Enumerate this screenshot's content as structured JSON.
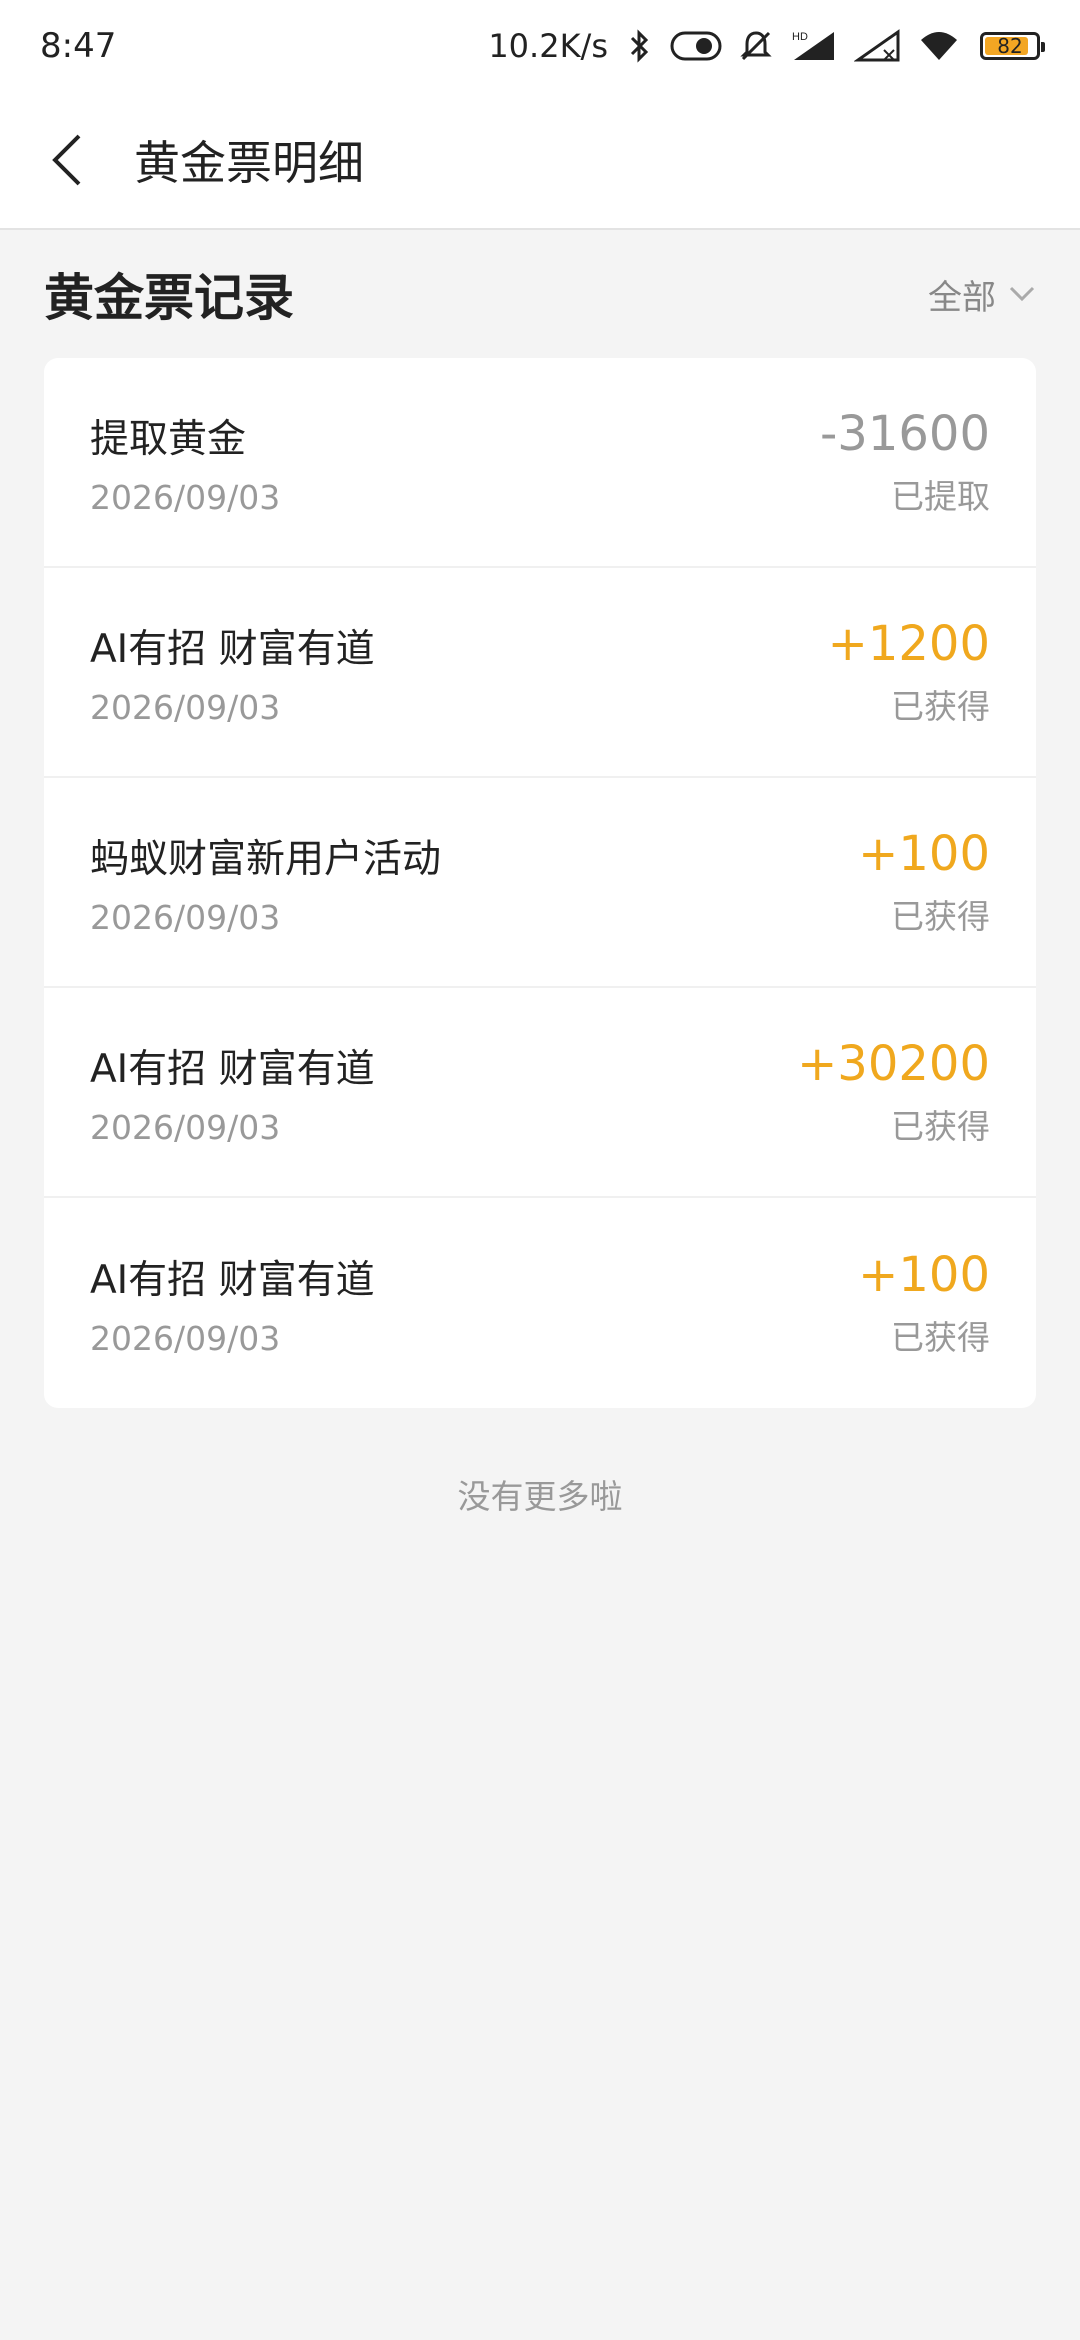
{
  "status_bar": {
    "time": "8:47",
    "net_speed": "10.2K/s",
    "battery": "82",
    "battery_color": "#f3a623"
  },
  "nav": {
    "back_icon": "chevron-left-icon",
    "title": "黄金票明细"
  },
  "section": {
    "title": "黄金票记录",
    "filter_label": "全部",
    "filter_icon": "chevron-down-icon"
  },
  "records": [
    {
      "title": "提取黄金",
      "date": "2026/09/03",
      "amount": "-31600",
      "status": "已提取"
    },
    {
      "title": "AI有招 财富有道",
      "date": "2026/09/03",
      "amount": "+1200",
      "status": "已获得"
    },
    {
      "title": "蚂蚁财富新用户活动",
      "date": "2026/09/03",
      "amount": "+100",
      "status": "已获得"
    },
    {
      "title": "AI有招 财富有道",
      "date": "2026/09/03",
      "amount": "+30200",
      "status": "已获得"
    },
    {
      "title": "AI有招 财富有道",
      "date": "2026/09/03",
      "amount": "+100",
      "status": "已获得"
    }
  ],
  "footer": {
    "no_more": "没有更多啦"
  },
  "colors": {
    "positive": "#f0a81e",
    "negative": "#999999"
  }
}
